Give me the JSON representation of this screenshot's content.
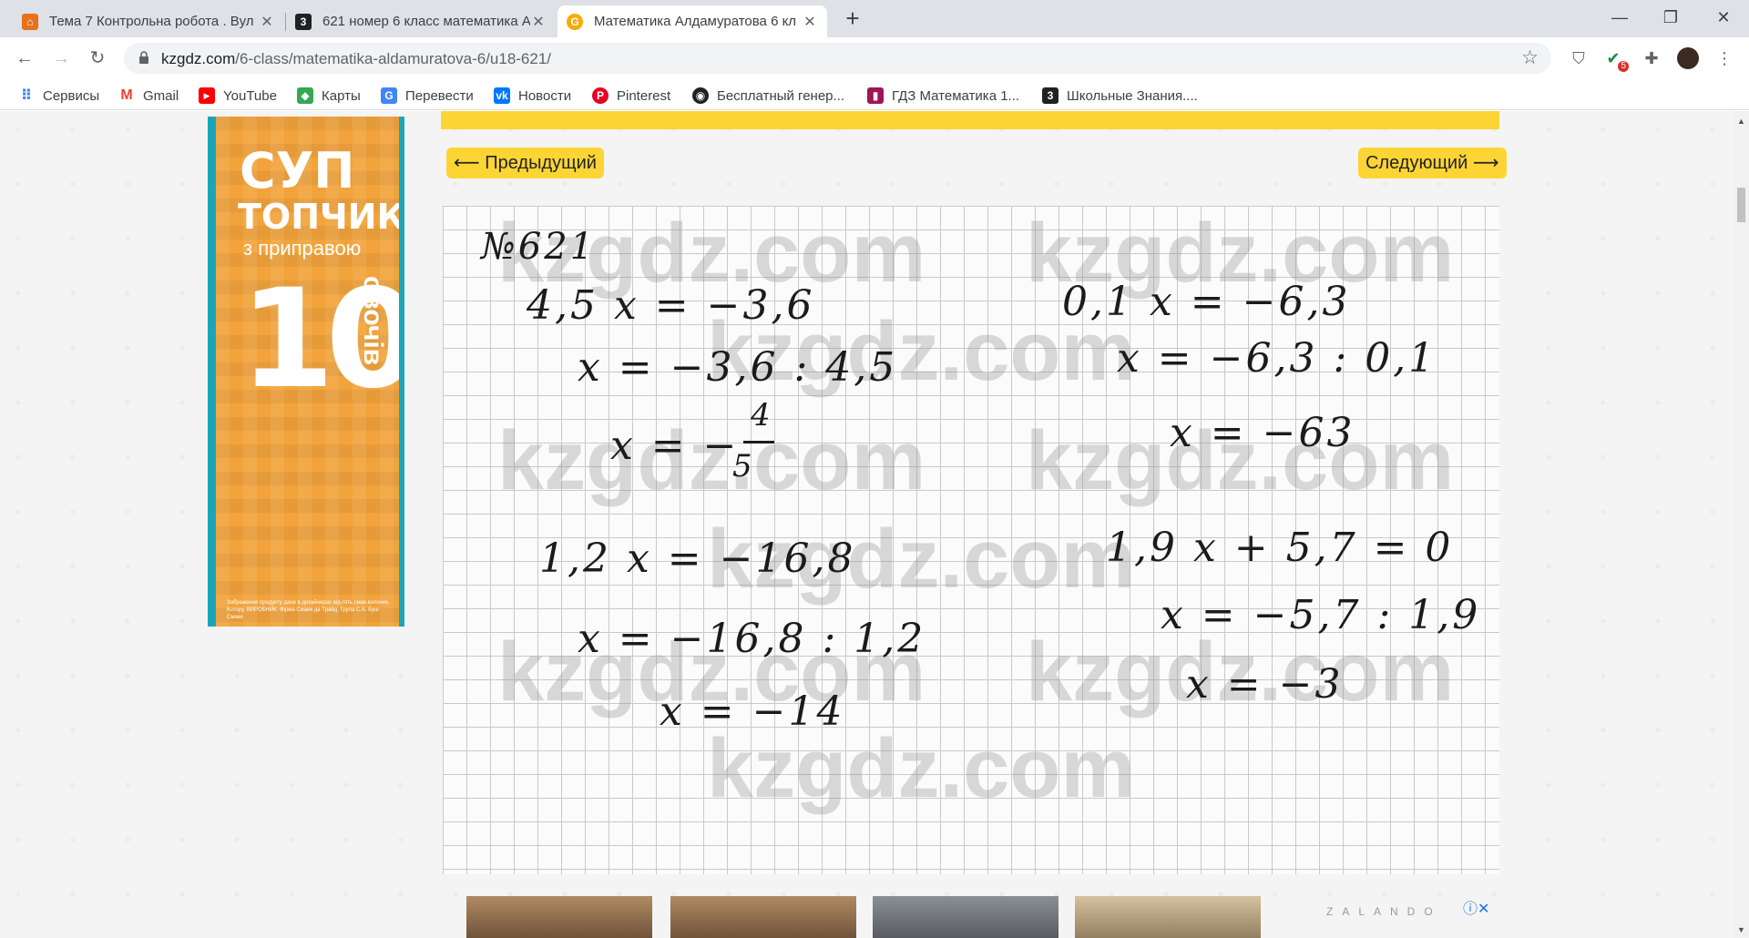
{
  "tabs": [
    {
      "title": "Тема 7 Контрольна робота . Вул",
      "icon": "orange-classroom-icon",
      "color": "#e8711c"
    },
    {
      "title": "621 номер 6 класс математика А",
      "icon": "kzgdz-3-icon",
      "color": "#202124"
    },
    {
      "title": "Математика Алдамуратова 6 кл",
      "icon": "kzgdz-site-icon",
      "color": "#f9ab00"
    }
  ],
  "window": {
    "minimize": "—",
    "restore": "❐",
    "close": "✕"
  },
  "omnibox": {
    "host": "kzgdz.com",
    "path": "/6-class/matematika-aldamuratova-6/u18-621/"
  },
  "extensions": {
    "badge_count": "5"
  },
  "bookmarks": [
    {
      "label": "Сервисы",
      "icon": "apps-grid-icon"
    },
    {
      "label": "Gmail",
      "icon": "gmail-icon"
    },
    {
      "label": "YouTube",
      "icon": "youtube-icon"
    },
    {
      "label": "Карты",
      "icon": "maps-icon"
    },
    {
      "label": "Перевести",
      "icon": "translate-icon"
    },
    {
      "label": "Новости",
      "icon": "vk-icon"
    },
    {
      "label": "Pinterest",
      "icon": "pinterest-icon"
    },
    {
      "label": "Бесплатный генер...",
      "icon": "generator-icon"
    },
    {
      "label": "ГДЗ Математика 1...",
      "icon": "book-icon"
    },
    {
      "label": "Школьные Знания....",
      "icon": "znanija-icon"
    }
  ],
  "pager": {
    "prev": "⟵ Предыдущий",
    "next": "Следующий ⟶"
  },
  "ad_side": {
    "line1": "СУП",
    "line2": "ТОПЧИК",
    "line3": "з приправою",
    "line4": "10",
    "line5": "овочів",
    "fine_print": "Зображення продукту дане в дизайнерах від-гять смак-колоних. Котору. ВИРОБНИК: Фірма Смаки да Трайд. Група С.А. Буш Смаки"
  },
  "solution": {
    "number": "№621",
    "left_lines": [
      "4,5 x = −3,6",
      "x = −3,6 : 4,5",
      "x = −",
      "1,2 x = −16,8",
      "x = −16,8 : 1,2",
      "x = −14"
    ],
    "fraction": {
      "num": "4",
      "den": "5"
    },
    "right_lines": [
      "0,1 x = −6,3",
      "x = −6,3 : 0,1",
      "x = −63",
      "1,9 x + 5,7 = 0",
      "x = −5,7 : 1,9",
      "x = −3"
    ],
    "watermark": "kzgdz.com"
  },
  "ad_bottom": {
    "brand": "ZALANDO",
    "close": "ⓘ✕"
  }
}
